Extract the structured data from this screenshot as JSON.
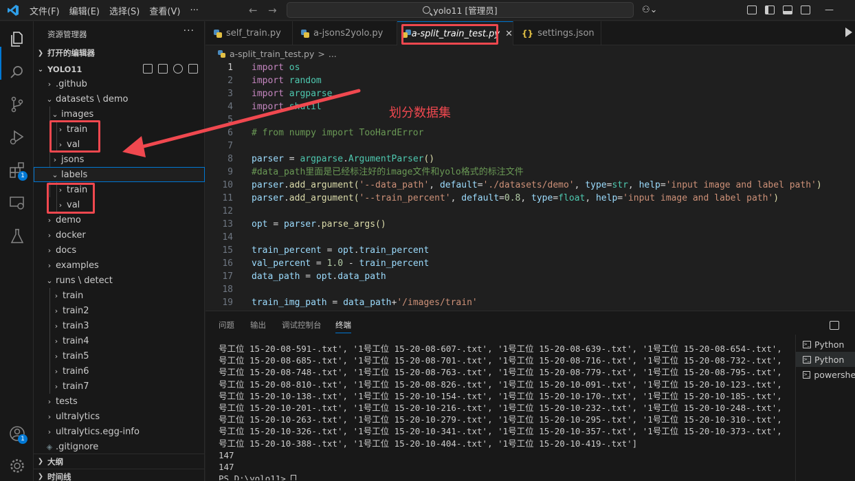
{
  "menu": [
    "文件(F)",
    "编辑(E)",
    "选择(S)",
    "查看(V)",
    "···"
  ],
  "command_center": "yolo11 [管理员]",
  "sidebar": {
    "title": "资源管理器",
    "more": "···",
    "open_editors": "打开的编辑器",
    "root": "YOLO11",
    "items": [
      {
        "label": ".github"
      },
      {
        "label": "datasets \\ demo"
      },
      {
        "label": "images"
      },
      {
        "label": "train"
      },
      {
        "label": "val"
      },
      {
        "label": "jsons"
      },
      {
        "label": "labels"
      },
      {
        "label": "train"
      },
      {
        "label": "val"
      },
      {
        "label": "demo"
      },
      {
        "label": "docker"
      },
      {
        "label": "docs"
      },
      {
        "label": "examples"
      },
      {
        "label": "runs \\ detect"
      },
      {
        "label": "train"
      },
      {
        "label": "train2"
      },
      {
        "label": "train3"
      },
      {
        "label": "train4"
      },
      {
        "label": "train5"
      },
      {
        "label": "train6"
      },
      {
        "label": "train7"
      },
      {
        "label": "tests"
      },
      {
        "label": "ultralytics"
      },
      {
        "label": "ultralytics.egg-info"
      },
      {
        "label": ".gitignore"
      }
    ],
    "outline": "大纲",
    "timeline": "时间线"
  },
  "activity_badges": {
    "extensions": "1",
    "accounts": "1"
  },
  "tabs": [
    {
      "label": "self_train.py"
    },
    {
      "label": "a-jsons2yolo.py"
    },
    {
      "label": "a-split_train_test.py"
    },
    {
      "label": "settings.json"
    }
  ],
  "breadcrumb": {
    "file": "a-split_train_test.py",
    "sep": ">",
    "more": "..."
  },
  "editor": {
    "line_numbers": [
      "1",
      "2",
      "3",
      "4",
      "5",
      "6",
      "7",
      "8",
      "9",
      "10",
      "11",
      "12",
      "13",
      "14",
      "15",
      "16",
      "17",
      "18",
      "19"
    ],
    "lines": [
      "import os",
      "import random",
      "import argparse",
      "import shutil",
      "",
      "# from numpy import TooHardError",
      "",
      "parser = argparse.ArgumentParser()",
      "#data_path里面是已经标注好的image文件和yolo格式的标注文件",
      "parser.add_argument('--data_path', default='./datasets/demo', type=str, help='input image and label path')",
      "parser.add_argument('--train_percent', default=0.8, type=float, help='input image and label path')",
      "",
      "opt = parser.parse_args()",
      "",
      "train_percent = opt.train_percent",
      "val_percent = 1.0 - train_percent",
      "data_path = opt.data_path",
      "",
      "train_img_path = data_path+'/images/train'"
    ]
  },
  "annotation": "划分数据集",
  "panel": {
    "tabs": [
      "问题",
      "输出",
      "调试控制台",
      "终端"
    ],
    "terminal_lines": [
      "号工位 15-20-08-591-.txt', '1号工位 15-20-08-607-.txt', '1号工位 15-20-08-639-.txt', '1号工位 15-20-08-654-.txt', '1",
      "号工位 15-20-08-685-.txt', '1号工位 15-20-08-701-.txt', '1号工位 15-20-08-716-.txt', '1号工位 15-20-08-732-.txt', '1",
      "号工位 15-20-08-748-.txt', '1号工位 15-20-08-763-.txt', '1号工位 15-20-08-779-.txt', '1号工位 15-20-08-795-.txt', '1",
      "号工位 15-20-08-810-.txt', '1号工位 15-20-08-826-.txt', '1号工位 15-20-10-091-.txt', '1号工位 15-20-10-123-.txt', '1",
      "号工位 15-20-10-138-.txt', '1号工位 15-20-10-154-.txt', '1号工位 15-20-10-170-.txt', '1号工位 15-20-10-185-.txt', '1",
      "号工位 15-20-10-201-.txt', '1号工位 15-20-10-216-.txt', '1号工位 15-20-10-232-.txt', '1号工位 15-20-10-248-.txt', '1",
      "号工位 15-20-10-263-.txt', '1号工位 15-20-10-279-.txt', '1号工位 15-20-10-295-.txt', '1号工位 15-20-10-310-.txt', '1",
      "号工位 15-20-10-326-.txt', '1号工位 15-20-10-341-.txt', '1号工位 15-20-10-357-.txt', '1号工位 15-20-10-373-.txt', '1",
      "号工位 15-20-10-388-.txt', '1号工位 15-20-10-404-.txt', '1号工位 15-20-10-419-.txt']",
      "147",
      "147"
    ],
    "prompt": "PS D:\\yolo11> ",
    "terminals": [
      "Python",
      "Python",
      "powershell"
    ]
  },
  "colors": {
    "accent": "#0078d4",
    "annotation": "#f0484f",
    "bg": "#1f1f1f"
  }
}
